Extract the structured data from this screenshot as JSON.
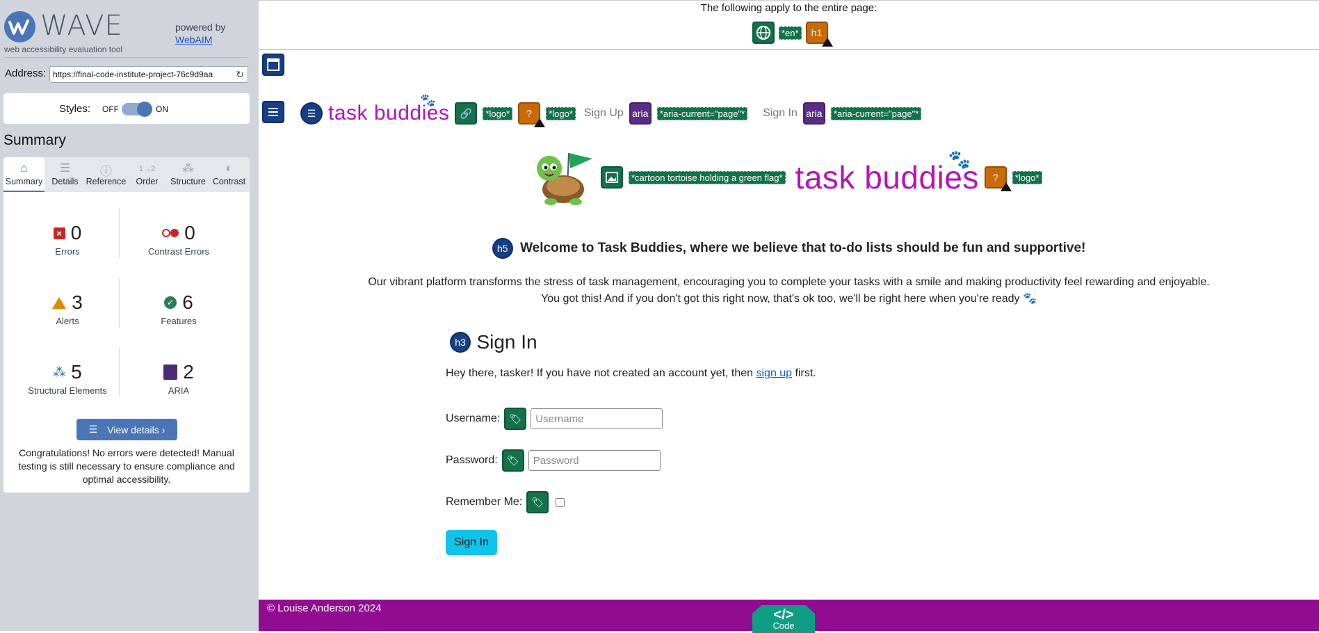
{
  "wave": {
    "logo_word": "WAVE",
    "tagline": "web accessibility evaluation tool",
    "powered_by": "powered by",
    "webaim_link": "WebAIM",
    "address_label": "Address:",
    "address_value": "https://final-code-institute-project-76c9d9aa",
    "styles_label": "Styles:",
    "styles_off": "OFF",
    "styles_on": "ON",
    "styles_on_state": true,
    "summary_heading": "Summary",
    "tabs": [
      {
        "label": "Summary",
        "icon": "home-icon",
        "active": true
      },
      {
        "label": "Details",
        "icon": "list-icon"
      },
      {
        "label": "Reference",
        "icon": "info-icon"
      },
      {
        "label": "Order",
        "icon": "order-icon"
      },
      {
        "label": "Structure",
        "icon": "structure-icon"
      },
      {
        "label": "Contrast",
        "icon": "contrast-icon"
      }
    ],
    "stats": {
      "errors": {
        "count": "0",
        "label": "Errors",
        "color": "#c62828"
      },
      "contrast_errors": {
        "count": "0",
        "label": "Contrast Errors",
        "color": "#c62828"
      },
      "alerts": {
        "count": "3",
        "label": "Alerts",
        "color": "#e08a00"
      },
      "features": {
        "count": "6",
        "label": "Features",
        "color": "#2e7d57"
      },
      "structural": {
        "count": "5",
        "label": "Structural Elements",
        "color": "#2563a8"
      },
      "aria": {
        "count": "2",
        "label": "ARIA",
        "color": "#4c2a7a"
      }
    },
    "view_details": "View details ›",
    "congrats": "Congratulations! No errors were detected! Manual testing is still necessary to ensure compliance and optimal accessibility."
  },
  "page": {
    "entire_page_text": "The following apply to the entire page:",
    "lang_tag": "*en*",
    "h1_label": "h1",
    "h5_label": "h5",
    "h3_label": "h3",
    "aria_label": "aria",
    "brand": "task buddies",
    "logo_tag": "*logo*",
    "nav_signup": "Sign Up",
    "nav_signin": "Sign In",
    "aria_current_tag": "*aria-current=\"page\"*",
    "tortoise_alt": "*cartoon tortoise holding a green flag*",
    "welcome_heading": "Welcome to Task Buddies, where we believe that to-do lists should be fun and supportive!",
    "intro_line1": "Our vibrant platform transforms the stress of task management, encouraging you to complete your tasks with a smile and making productivity feel rewarding and enjoyable.",
    "intro_line2": "You got this! And if you don't got this right now, that's ok too, we'll be right here when you're ready 🐾",
    "signin_heading": "Sign In",
    "hey_prefix": "Hey there, tasker! If you have not created an account yet, then ",
    "hey_link": "sign up",
    "hey_suffix": " first.",
    "username_label": "Username:",
    "username_placeholder": "Username",
    "password_label": "Password:",
    "password_placeholder": "Password",
    "remember_label": "Remember Me:",
    "signin_button": "Sign In",
    "footer": "© Louise Anderson 2024",
    "code_icon_glyph": "</>",
    "code_label": "Code"
  }
}
